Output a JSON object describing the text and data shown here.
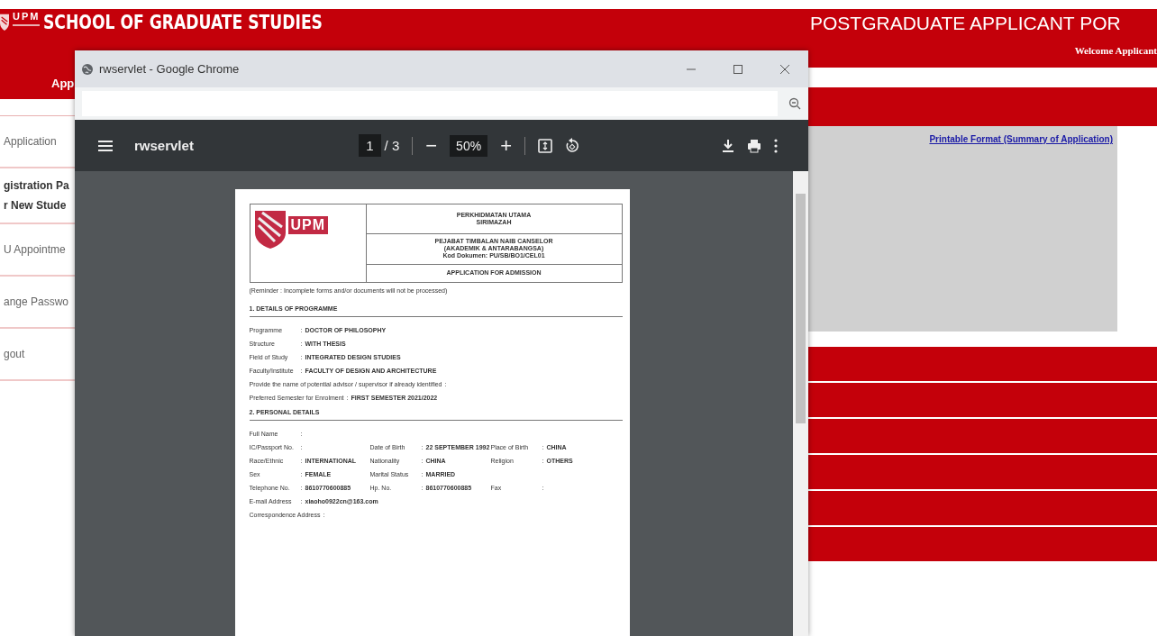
{
  "portal": {
    "logo_text": "UPM",
    "school": "SCHOOL OF GRADUATE STUDIES",
    "title": "POSTGRADUATE APPLICANT POR",
    "welcome": "Welcome Applicant",
    "nav_tab": "App",
    "link": "Printable Format (Summary of Application)",
    "sidebar": [
      {
        "lines": [
          "Application"
        ]
      },
      {
        "lines": [
          "gistration Pa",
          "r New Stude"
        ],
        "bold": true
      },
      {
        "lines": [
          "U Appointme"
        ]
      },
      {
        "lines": [
          "ange Passwo"
        ]
      },
      {
        "lines": [
          "gout"
        ]
      }
    ]
  },
  "window": {
    "title": "rwservlet - Google Chrome"
  },
  "viewer": {
    "file": "rwservlet",
    "page": "1",
    "pages": "/ 3",
    "zoom": "50%",
    "minus": "−",
    "plus": "+"
  },
  "document": {
    "logo_text": "UPM",
    "colon": ":",
    "header": [
      "PERKHIDMATAN UTAMA\nSIRIMAZAH",
      "PEJABAT TIMBALAN NAIB CANSELOR\n(AKADEMIK & ANTARABANGSA)\nKod Dokumen: PU/SB/BO1/CEL01",
      "APPLICATION FOR ADMISSION"
    ],
    "reminder": "(Reminder : Incomplete forms and/or documents will not be processed)",
    "sections": [
      {
        "heading": "1.  DETAILS OF PROGRAMME",
        "rows": [
          [
            {
              "label": "Programme",
              "value": "DOCTOR OF PHILOSOPHY"
            }
          ],
          [
            {
              "label": "Structure",
              "value": "WITH THESIS"
            }
          ],
          [
            {
              "label": "Field of Study",
              "value": "INTEGRATED DESIGN STUDIES"
            }
          ],
          [
            {
              "label": "Faculty/Institute",
              "value": "FACULTY OF DESIGN AND ARCHITECTURE"
            }
          ],
          [
            {
              "label": "Provide the name of potential advisor / supervisor if already identified"
            }
          ],
          [
            {
              "label": "Preferred Semester for Enrolment",
              "value": "FIRST SEMESTER 2021/2022"
            }
          ]
        ]
      },
      {
        "heading": "2.  PERSONAL DETAILS",
        "rows": [
          [
            {
              "label": "Full Name"
            }
          ],
          [
            {
              "label": "IC/Passport No."
            },
            {
              "label": "Date of Birth",
              "value": "22 SEPTEMBER 1992"
            },
            {
              "label": "Place of Birth",
              "value": "CHINA"
            }
          ],
          [
            {
              "label": "Race/Ethnic",
              "value": "INTERNATIONAL"
            },
            {
              "label": "Nationality",
              "value": "CHINA"
            },
            {
              "label": "Religion",
              "value": "OTHERS"
            }
          ],
          [
            {
              "label": "Sex",
              "value": "FEMALE"
            },
            {
              "label": "Marital Status",
              "value": "MARRIED"
            }
          ],
          [
            {
              "label": "Telephone No.",
              "value": "8610770600885"
            },
            {
              "label": "Hp. No.",
              "value": "8610770600885"
            },
            {
              "label": "Fax"
            }
          ],
          [
            {
              "label": "E-mail Address",
              "value": "xiaoho0922cn@163.com"
            }
          ],
          [
            {
              "label": "Correspondence Address"
            }
          ]
        ]
      }
    ]
  }
}
